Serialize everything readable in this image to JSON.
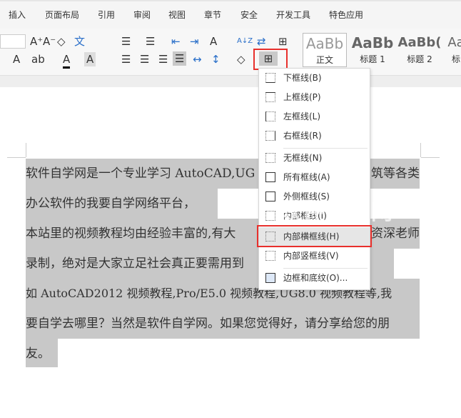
{
  "tabs": [
    "插入",
    "页面布局",
    "引用",
    "审阅",
    "视图",
    "章节",
    "安全",
    "开发工具",
    "特色应用"
  ],
  "styles": [
    {
      "sample": "AaBb",
      "label": "正文"
    },
    {
      "sample": "AaBb",
      "label": "标题 1"
    },
    {
      "sample": "AaBb(",
      "label": "标题 2"
    },
    {
      "sample": "Aa",
      "label": "标"
    }
  ],
  "toolbar": {
    "grow": "A⁺",
    "shrink": "A⁻",
    "clear": "◇",
    "pinyin": "文",
    "fontA": "A",
    "highlight": "ab",
    "color": "A",
    "shade": "A",
    "sort": "A↓Z",
    "charscale": "A"
  },
  "menu": {
    "items": [
      {
        "label": "下框线(B)"
      },
      {
        "label": "上框线(P)"
      },
      {
        "label": "左框线(L)"
      },
      {
        "label": "右框线(R)"
      },
      {
        "label": "无框线(N)"
      },
      {
        "label": "所有框线(A)"
      },
      {
        "label": "外侧框线(S)"
      },
      {
        "label": "内部框线(I)"
      },
      {
        "label": "内部横框线(H)",
        "highlighted": true
      },
      {
        "label": "内部竖框线(V)"
      },
      {
        "label": "边框和底纹(O)..."
      }
    ]
  },
  "doc": {
    "l1a": "软件自学网是一个专业学习 AutoCAD,UG",
    "l1b": "筑等各类",
    "l2": "办公软件的我要自学网络平台，",
    "l3a": "本站里的视频教程均由经验丰富的,有大",
    "l3b": "资深老师",
    "l4": "录制，绝对是大家立足社会真正要需用到",
    "l5": "如 AutoCAD2012 视频教程,Pro/E5.0 视频教程,UG8.0 视频教程等,我",
    "l6": "要自学去哪里？当然是软件自学网。如果您觉得好，请分享给您的朋",
    "l7": "友。"
  },
  "watermark": "软件自学网",
  "accent": "#e8302c"
}
